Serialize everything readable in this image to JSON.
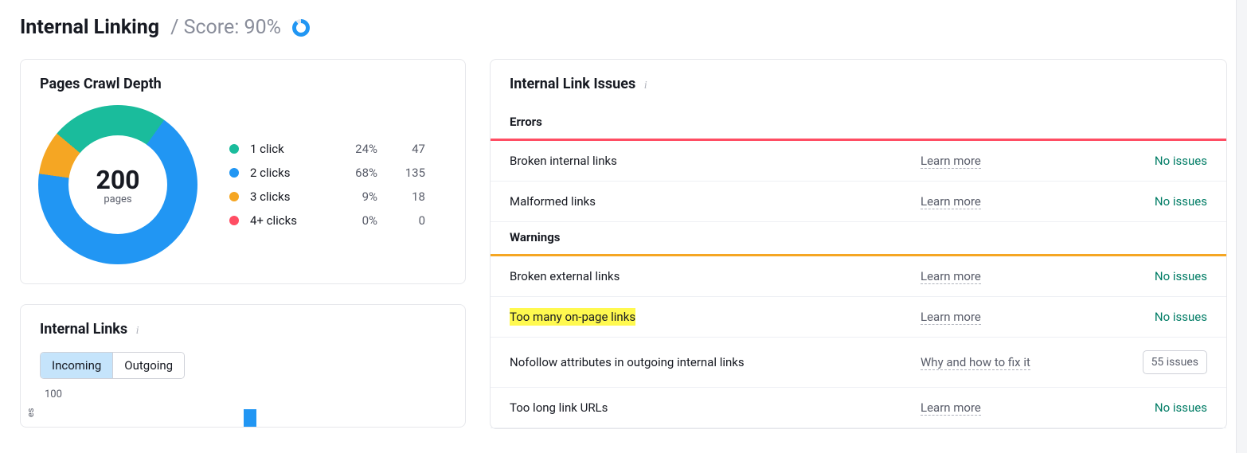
{
  "header": {
    "title": "Internal Linking",
    "score_label": "/ Score: 90%"
  },
  "crawl_depth": {
    "title": "Pages Crawl Depth",
    "total": "200",
    "unit": "pages",
    "legend": [
      {
        "label": "1 click",
        "pct": "24%",
        "count": "47",
        "color": "c-green"
      },
      {
        "label": "2 clicks",
        "pct": "68%",
        "count": "135",
        "color": "c-blue"
      },
      {
        "label": "3 clicks",
        "pct": "9%",
        "count": "18",
        "color": "c-orange"
      },
      {
        "label": "4+ clicks",
        "pct": "0%",
        "count": "0",
        "color": "c-red"
      }
    ]
  },
  "internal_links": {
    "title": "Internal Links",
    "tabs": {
      "incoming": "Incoming",
      "outgoing": "Outgoing"
    },
    "y_tick": "100",
    "y_label": "es"
  },
  "issues": {
    "title": "Internal Link Issues",
    "errors_label": "Errors",
    "warnings_label": "Warnings",
    "learn_more": "Learn more",
    "why_fix": "Why and how to fix it",
    "no_issues": "No issues",
    "errors": [
      {
        "name": "Broken internal links"
      },
      {
        "name": "Malformed links"
      }
    ],
    "warnings": [
      {
        "name": "Broken external links",
        "status": "no"
      },
      {
        "name": "Too many on-page links",
        "status": "no",
        "highlight": true
      },
      {
        "name": "Nofollow attributes in outgoing internal links",
        "status": "55 issues",
        "fix": true
      },
      {
        "name": "Too long link URLs",
        "status": "no"
      }
    ]
  },
  "chart_data": {
    "type": "pie",
    "title": "Pages Crawl Depth",
    "categories": [
      "1 click",
      "2 clicks",
      "3 clicks",
      "4+ clicks"
    ],
    "values": [
      47,
      135,
      18,
      0
    ],
    "percentages": [
      24,
      68,
      9,
      0
    ],
    "total": 200,
    "unit": "pages",
    "colors": [
      "#1abc9c",
      "#2196f3",
      "#f5a623",
      "#ff4d63"
    ]
  }
}
